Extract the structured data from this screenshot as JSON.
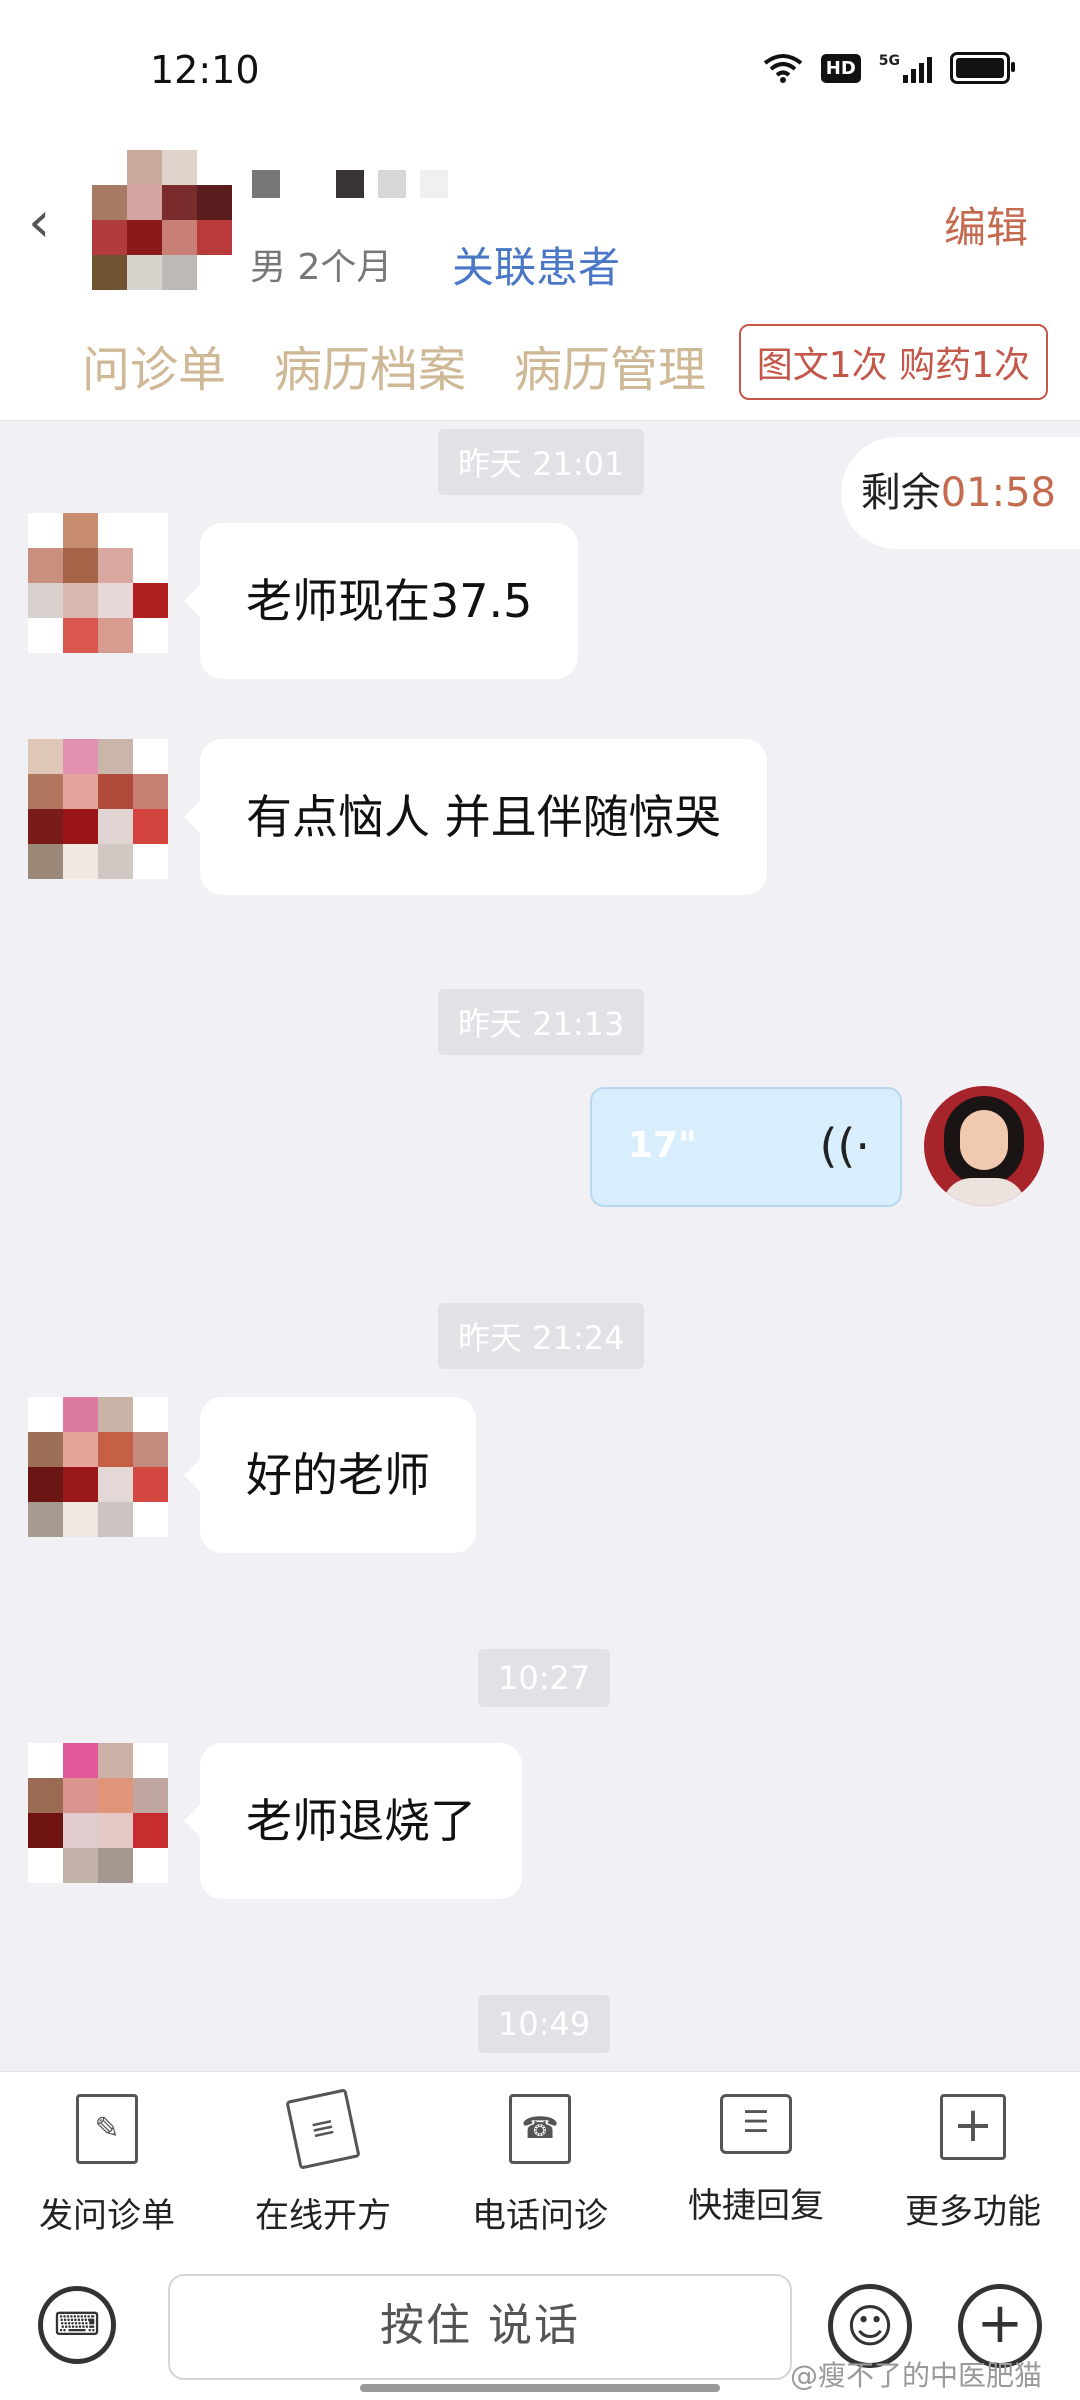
{
  "status_bar": {
    "time": "12:10",
    "hd_badge": "HD",
    "net_badge": "5G"
  },
  "header": {
    "back_icon": "back-arrow-icon",
    "patient_info": "男 2个月",
    "link_patient": "关联患者",
    "edit": "编辑",
    "tabs": [
      "问诊单",
      "病历档案",
      "病历管理"
    ],
    "quota": "图文1次 购药1次"
  },
  "chat": {
    "remaining_label": "剩余",
    "remaining_time": "01:58",
    "timestamps": [
      "昨天 21:01",
      "昨天 21:13",
      "昨天 21:24",
      "10:27",
      "10:49"
    ],
    "messages": [
      {
        "from": "patient",
        "text": "老师现在37.5"
      },
      {
        "from": "patient",
        "text": "有点恼人 并且伴随惊哭"
      },
      {
        "from": "doctor",
        "type": "voice",
        "duration": "17\""
      },
      {
        "from": "patient",
        "text": "好的老师"
      },
      {
        "from": "patient",
        "text": "老师退烧了"
      }
    ]
  },
  "toolbar": {
    "items": [
      {
        "label": "发问诊单",
        "icon": "form-edit-icon"
      },
      {
        "label": "在线开方",
        "icon": "prescription-icon"
      },
      {
        "label": "电话问诊",
        "icon": "phone-icon"
      },
      {
        "label": "快捷回复",
        "icon": "quick-reply-icon"
      },
      {
        "label": "更多功能",
        "icon": "plus-square-icon"
      }
    ]
  },
  "input": {
    "hold_to_talk": "按住 说话"
  },
  "watermark": "@瘦不了的中医肥猫",
  "colors": {
    "accent_link": "#4a78c7",
    "edit_red": "#c46a4e",
    "tab_gold": "#cfb896",
    "quota_red": "#c2574a"
  }
}
